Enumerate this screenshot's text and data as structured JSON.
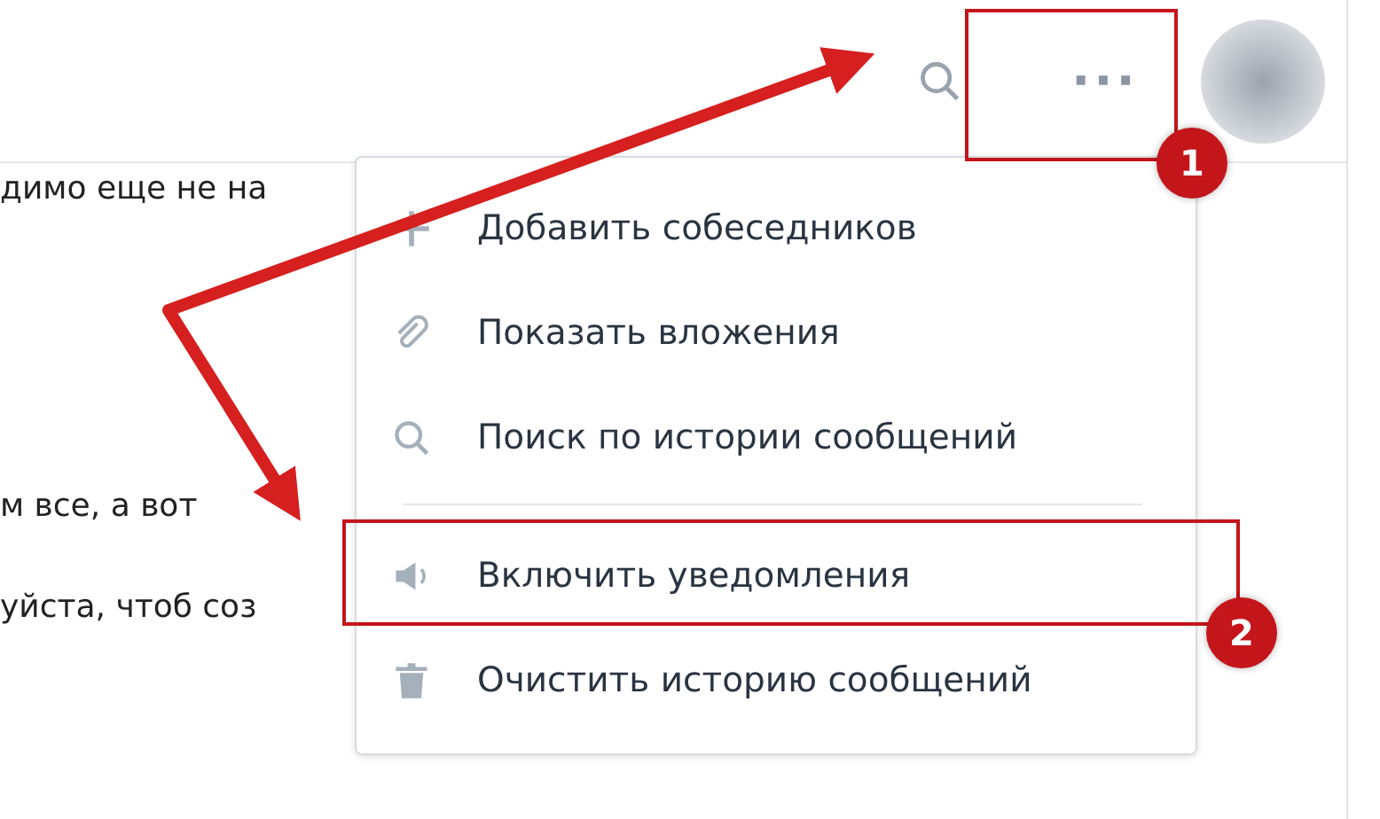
{
  "header": {
    "more_button": "···"
  },
  "messages": [
    "димо еще не на",
    "м все, а вот",
    "уйста, чтоб соз"
  ],
  "menu": {
    "items": [
      {
        "label": "Добавить собеседников"
      },
      {
        "label": "Показать вложения"
      },
      {
        "label": "Поиск по истории сообщений"
      },
      {
        "label": "Включить уведомления"
      },
      {
        "label": "Очистить историю сообщений"
      }
    ]
  },
  "callouts": [
    {
      "number": "1"
    },
    {
      "number": "2"
    }
  ]
}
